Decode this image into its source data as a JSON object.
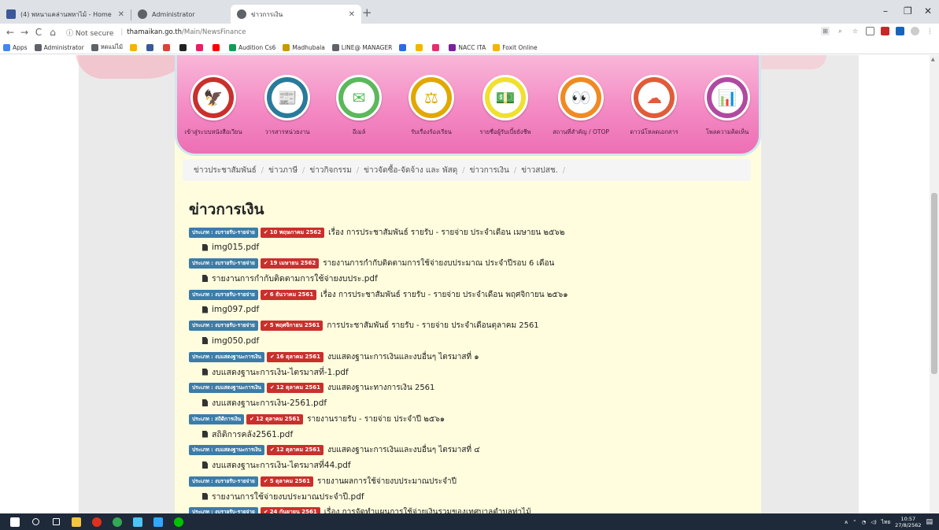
{
  "browser": {
    "tabs": [
      {
        "label": "(4) พหนาแคล่านพหาไม้ - Home",
        "favicon": "facebook-icon",
        "color": "#3b5998"
      },
      {
        "label": "Administrator",
        "favicon": "globe-icon",
        "color": "#5f6368"
      },
      {
        "label": "ข่าวการเงิน",
        "favicon": "globe-icon",
        "color": "#5f6368"
      }
    ],
    "new_tab": "+",
    "window_controls": [
      "–",
      "❐",
      "✕"
    ],
    "nav": {
      "back": "←",
      "forward": "→",
      "reload": "C",
      "home": "⌂"
    },
    "security": "ⓘ Not secure",
    "url_host": "thamaikan.go.th",
    "url_path": "/Main/NewsFinance",
    "bookmarks": [
      {
        "label": "Apps",
        "color": "#4285f4"
      },
      {
        "label": "Administrator",
        "color": "#5f6368"
      },
      {
        "label": "หดแม่ไม้",
        "color": "#5f6368"
      },
      {
        "label": "",
        "color": "#f4b400"
      },
      {
        "label": "",
        "color": "#3b5998"
      },
      {
        "label": "",
        "color": "#db4437"
      },
      {
        "label": "",
        "color": "#222222"
      },
      {
        "label": "",
        "color": "#e91e63"
      },
      {
        "label": "",
        "color": "#ff0000"
      },
      {
        "label": "Audition Cs6",
        "color": "#0f9d58"
      },
      {
        "label": "Madhubala",
        "color": "#c79a00"
      },
      {
        "label": "LINE@ MANAGER",
        "color": "#5f6368"
      },
      {
        "label": "",
        "color": "#2d6be4"
      },
      {
        "label": "",
        "color": "#f4b400"
      },
      {
        "label": "",
        "color": "#e1306c"
      },
      {
        "label": "NACC ITA",
        "color": "#7b1fa2"
      },
      {
        "label": "Foxit Online",
        "color": "#f4b400"
      }
    ]
  },
  "quick_links": [
    {
      "label": "เข้าสู่ระบบหนังสือเวียน",
      "color": "#c9302c",
      "glyph": "🦅",
      "icon": "garuda-icon"
    },
    {
      "label": "วารสารหน่วยงาน",
      "color": "#2a7a9a",
      "glyph": "📰",
      "icon": "journal-icon"
    },
    {
      "label": "อีเมล์",
      "color": "#5cb85c",
      "glyph": "✉",
      "icon": "mail-icon"
    },
    {
      "label": "รับเรื่องร้องเรียน",
      "color": "#e0a800",
      "glyph": "⚖",
      "icon": "scale-icon"
    },
    {
      "label": "รายชื่อผู้รับเบี้ยยังชีพ",
      "color": "#f0e030",
      "glyph": "💵",
      "icon": "money-icon"
    },
    {
      "label": "สถานที่สำคัญ / OTOP",
      "color": "#f08a24",
      "glyph": "👀",
      "icon": "binoculars-icon"
    },
    {
      "label": "ดาวน์โหลดเอกสาร",
      "color": "#e05c3a",
      "glyph": "☁",
      "icon": "cloud-download-icon"
    },
    {
      "label": "โพลความคิดเห็น",
      "color": "#b04aa0",
      "glyph": "📊",
      "icon": "poll-chart-icon"
    }
  ],
  "breadcrumb": [
    "ข่าวประชาสัมพันธ์",
    "ข่าวภาษี",
    "ข่าวกิจกรรม",
    "ข่าวจัดซื้อ-จัดจ้าง และ พัสดุ",
    "ข่าวการเงิน",
    "ข่าวสปสช."
  ],
  "page_title": "ข่าวการเงิน",
  "news": [
    {
      "category": "ประเภท : งบรายรับ-รายจ่าย",
      "date": "10 พฤษภาคม 2562",
      "title": "เรื่อง การประชาสัมพันธ์ รายรับ - รายจ่าย ประจำเดือน เมษายน ๒๕๖๒",
      "file": "img015.pdf"
    },
    {
      "category": "ประเภท : งบรายรับ-รายจ่าย",
      "date": "19 เมษายน 2562",
      "title": "รายงานการกำกับติดตามการใช้จ่ายงบประมาณ ประจำปีรอบ 6 เดือน",
      "file": "รายงานการกำกับติดตามการใช้จ่ายงบประ.pdf"
    },
    {
      "category": "ประเภท : งบรายรับ-รายจ่าย",
      "date": "6 ธันวาคม 2561",
      "title": "เรื่อง การประชาสัมพันธ์ รายรับ - รายจ่าย ประจำเดือน พฤศจิกายน ๒๕๖๑",
      "file": "img097.pdf"
    },
    {
      "category": "ประเภท : งบรายรับ-รายจ่าย",
      "date": "5 พฤศจิกายน 2561",
      "title": "การประชาสัมพันธ์ รายรับ - รายจ่าย ประจำเดือนตุลาคม 2561",
      "file": "img050.pdf"
    },
    {
      "category": "ประเภท : งบแสดงฐานะการเงิน",
      "date": "16 ตุลาคม 2561",
      "title": "งบแสดงฐานะการเงินและงบอื่นๆ ไตรมาสที่ ๑",
      "file": "งบแสดงฐานะการเงิน-ไตรมาสที่-1.pdf"
    },
    {
      "category": "ประเภท : งบแสดงฐานะการเงิน",
      "date": "12 ตุลาคม 2561",
      "title": "งบแสดงฐานะทางการเงิน 2561",
      "file": "งบแสดงฐานะการเงิน-2561.pdf"
    },
    {
      "category": "ประเภท : สถิติการเงิน",
      "date": "12 ตุลาคม 2561",
      "title": "รายงานรายรับ - รายจ่าย ประจำปี ๒๕๖๑",
      "file": "สถิติการคลัง2561.pdf"
    },
    {
      "category": "ประเภท : งบแสดงฐานะการเงิน",
      "date": "12 ตุลาคม 2561",
      "title": "งบแสดงฐานะการเงินและงบอื่นๆ ไตรมาสที่ ๔",
      "file": "งบแสดงฐานะการเงิน-ไตรมาสที่44.pdf"
    },
    {
      "category": "ประเภท : งบรายรับ-รายจ่าย",
      "date": "5 ตุลาคม 2561",
      "title": "รายงานผลการใช้จ่ายงบประมาณประจำปี",
      "file": "รายงานการใช้จ่ายงบประมาณประจำปี.pdf"
    },
    {
      "category": "ประเภท : งบรายรับ-รายจ่าย",
      "date": "24 กันยายน 2561",
      "title": "เรื่อง การจัดทำแผนการใช้จ่ายเงินรวมของเทศบาลตำบลท่าไม้",
      "file": ""
    }
  ],
  "taskbar": {
    "apps": [
      {
        "icon": "windows-start-icon",
        "color": "#ffffff"
      },
      {
        "icon": "search-icon",
        "color": "#ffffff"
      },
      {
        "icon": "task-view-icon",
        "color": "#ffffff"
      },
      {
        "icon": "file-explorer-icon",
        "color": "#f4c542"
      },
      {
        "icon": "opera-icon",
        "color": "#e0301e"
      },
      {
        "icon": "chrome-icon",
        "color": "#34a853"
      },
      {
        "icon": "app-icon",
        "color": "#4fc3f7"
      },
      {
        "icon": "photoshop-icon",
        "color": "#31a8ff"
      },
      {
        "icon": "line-icon",
        "color": "#00c300"
      }
    ],
    "ime": "ไทย",
    "time": "10:57",
    "date": "27/8/2562"
  }
}
